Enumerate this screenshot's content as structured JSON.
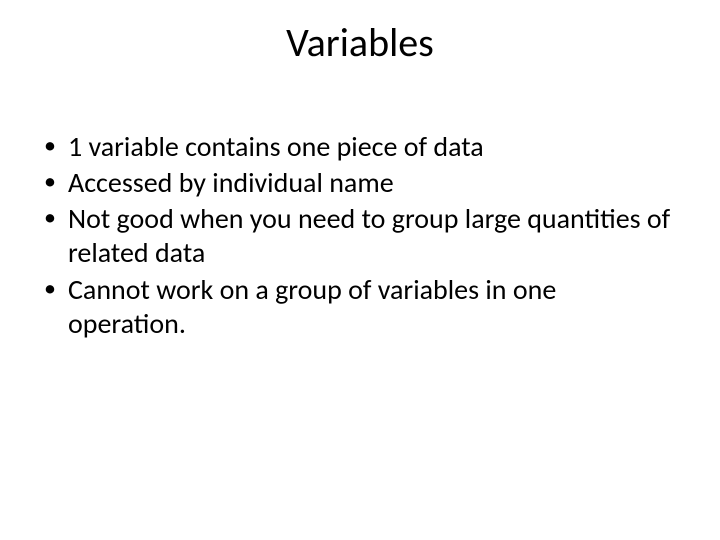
{
  "title": "Variables",
  "bullets": [
    "1 variable contains one piece of data",
    "Accessed by individual name",
    "Not good when you need to group large quantities of related data",
    "Cannot work on a group of variables in one operation."
  ]
}
